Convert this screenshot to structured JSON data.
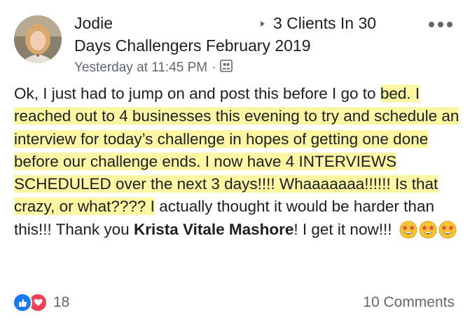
{
  "post": {
    "author": "Jodie",
    "group_line1": "3 Clients In 30",
    "group_line2": "Days Challengers February 2019",
    "timestamp": "Yesterday at 11:45 PM",
    "separator": "·",
    "privacy_icon": "group-icon",
    "more_icon": "more-options-icon",
    "body": {
      "line1": "Ok, I just had to jump on and post this before I go to",
      "highlighted": "bed. I reached out to 4 businesses this evening to try and schedule an interview for today’s challenge in hopes of getting one done before our challenge ends. I now have 4 INTERVIEWS SCHEDULED over the next 3 days!!!! Whaaaaaaa!!!!!! Is that crazy, or what???? I",
      "line_after": "actually thought it would be harder than this!!! Thank you",
      "mention": "Krista Vitale Mashore",
      "ending": "! I get it now!!!",
      "emoji_icon": "star-struck-emoji"
    },
    "reactions": {
      "icons": [
        "like-icon",
        "love-icon"
      ],
      "count": "18"
    },
    "comments": "10 Comments"
  },
  "colors": {
    "highlight": "#fdf7a3",
    "like": "#1877f2",
    "love": "#f33e58",
    "meta_text": "#606770"
  }
}
